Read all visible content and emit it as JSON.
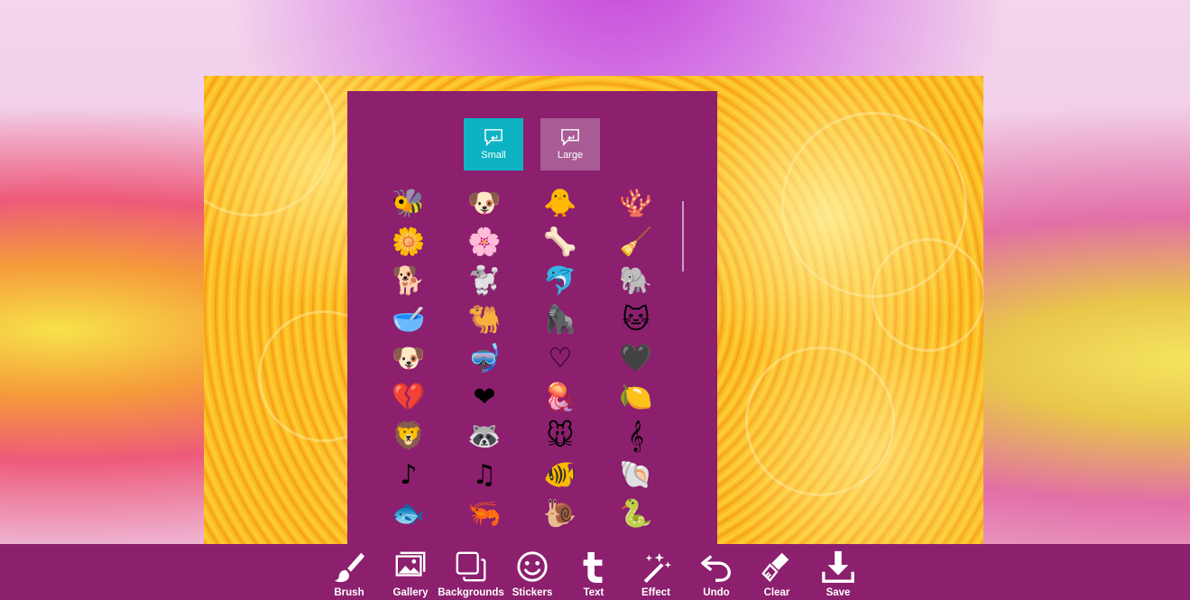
{
  "size_buttons": {
    "small": "Small",
    "large": "Large"
  },
  "stickers": [
    {
      "name": "bee",
      "glyph": "🐝"
    },
    {
      "name": "dog",
      "glyph": "🐶"
    },
    {
      "name": "chick",
      "glyph": "🐥"
    },
    {
      "name": "coral",
      "glyph": "🪸"
    },
    {
      "name": "orange-flower",
      "glyph": "🌼"
    },
    {
      "name": "daisy",
      "glyph": "🌸"
    },
    {
      "name": "bone",
      "glyph": "🦴"
    },
    {
      "name": "lint-roller",
      "glyph": "🧹"
    },
    {
      "name": "puppy",
      "glyph": "🐕"
    },
    {
      "name": "sleepy-dog",
      "glyph": "🐩"
    },
    {
      "name": "dolphin",
      "glyph": "🐬"
    },
    {
      "name": "elephant",
      "glyph": "🐘"
    },
    {
      "name": "pet-bowl",
      "glyph": "🥣"
    },
    {
      "name": "camel",
      "glyph": "🐫"
    },
    {
      "name": "gorilla",
      "glyph": "🦍"
    },
    {
      "name": "cat",
      "glyph": "🐱"
    },
    {
      "name": "cartoon-dog",
      "glyph": "🐶"
    },
    {
      "name": "snorkel-mask",
      "glyph": "🤿"
    },
    {
      "name": "heart-swirl",
      "glyph": "♡"
    },
    {
      "name": "dark-heart",
      "glyph": "🖤"
    },
    {
      "name": "broken-heart",
      "glyph": "💔"
    },
    {
      "name": "red-heart",
      "glyph": "❤"
    },
    {
      "name": "jellyfish",
      "glyph": "🪼"
    },
    {
      "name": "lemon",
      "glyph": "🍋"
    },
    {
      "name": "lion",
      "glyph": "🦁"
    },
    {
      "name": "raccoon",
      "glyph": "🦝"
    },
    {
      "name": "mouse",
      "glyph": "🐭"
    },
    {
      "name": "treble-clef",
      "glyph": "𝄞"
    },
    {
      "name": "eighth-note",
      "glyph": "♪"
    },
    {
      "name": "beamed-notes",
      "glyph": "♫"
    },
    {
      "name": "clownfish",
      "glyph": "🐠"
    },
    {
      "name": "shell",
      "glyph": "🐚"
    },
    {
      "name": "crystal-fish",
      "glyph": "🐟"
    },
    {
      "name": "shrimp",
      "glyph": "🦐"
    },
    {
      "name": "snail",
      "glyph": "🐌"
    },
    {
      "name": "snake",
      "glyph": "🐍"
    }
  ],
  "toolbar": {
    "brush": "Brush",
    "gallery": "Gallery",
    "backgrounds": "Backgrounds",
    "stickers": "Stickers",
    "text": "Text",
    "effect": "Effect",
    "undo": "Undo",
    "clear": "Clear",
    "save": "Save"
  },
  "colors": {
    "panel": "#8c1f6e",
    "selected": "#0db3c4",
    "unselected": "#a95b95"
  }
}
